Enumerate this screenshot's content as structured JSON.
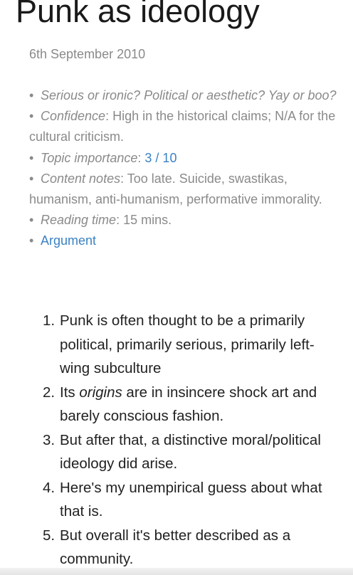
{
  "article": {
    "title": "Punk as ideology",
    "date": "6th September 2010"
  },
  "meta": {
    "bullet": "•",
    "item1": "Serious or ironic? Political or aesthetic? Yay or boo?",
    "confidence_label": "Confidence",
    "confidence_value": ": High in the historical claims; N/A for the cultural criticism.",
    "importance_label": "Topic importance",
    "importance_sep": ": ",
    "importance_value": "3 / 10",
    "notes_label": "Content notes",
    "notes_value": ": Too late. Suicide, swastikas, humanism, anti-humanism, performative immorality.",
    "reading_label": "Reading time",
    "reading_value": ": 15 mins.",
    "argument_link": "Argument"
  },
  "points": [
    {
      "num": "1.",
      "text": "Punk is often thought to be a primarily political, primarily serious, primarily left-wing subculture"
    },
    {
      "num": "2.",
      "pre": "Its ",
      "em": "origins",
      "post": " are in insincere shock art and barely conscious fashion."
    },
    {
      "num": "3.",
      "text": "But after that, a distinctive moral/political ideology did arise."
    },
    {
      "num": "4.",
      "text": "Here's my unempirical guess about what that is."
    },
    {
      "num": "5.",
      "text": "But overall it's better described as a community."
    }
  ]
}
